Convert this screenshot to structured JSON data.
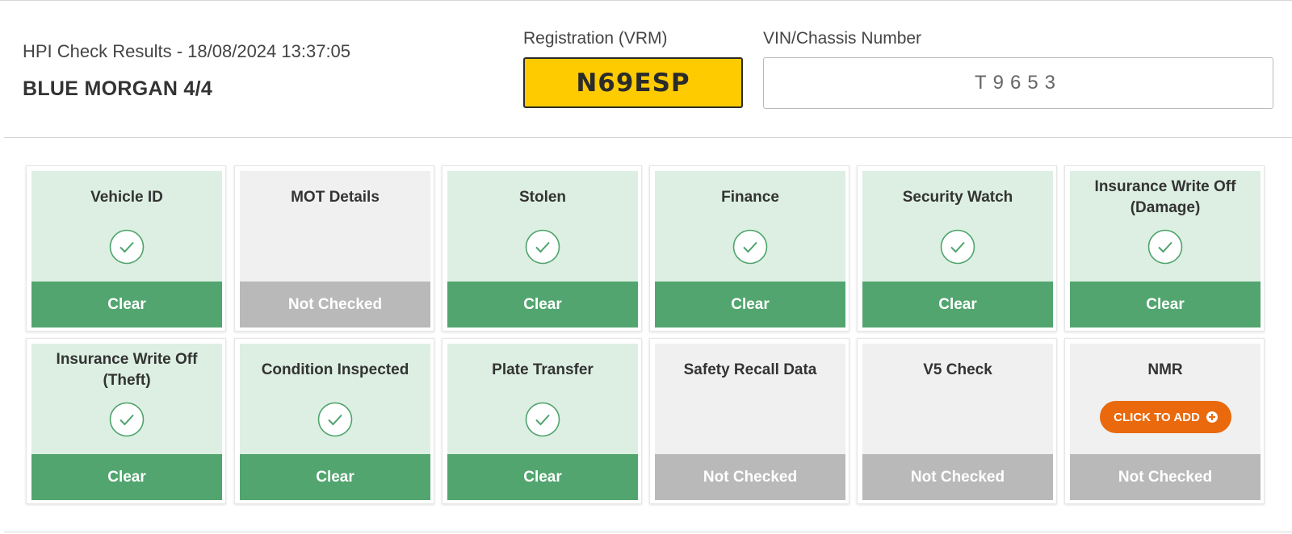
{
  "header": {
    "results_line": "HPI Check Results - 18/08/2024 13:37:05",
    "vehicle_name": "BLUE MORGAN 4/4",
    "registration_label": "Registration (VRM)",
    "registration_value": "N69ESP",
    "vin_label": "VIN/Chassis Number",
    "vin_value": "T9653"
  },
  "checks": [
    {
      "title": "Vehicle ID",
      "status": "Clear",
      "icon": "check-circle-icon"
    },
    {
      "title": "MOT Details",
      "status": "Not Checked"
    },
    {
      "title": "Stolen",
      "status": "Clear",
      "icon": "check-circle-icon"
    },
    {
      "title": "Finance",
      "status": "Clear",
      "icon": "check-circle-icon"
    },
    {
      "title": "Security Watch",
      "status": "Clear",
      "icon": "check-circle-icon"
    },
    {
      "title_line1": "Insurance Write Off",
      "title_line2": "(Damage)",
      "status": "Clear",
      "icon": "check-circle-icon"
    },
    {
      "title_line1": "Insurance Write Off",
      "title_line2": "(Theft)",
      "status": "Clear",
      "icon": "check-circle-icon"
    },
    {
      "title": "Condition Inspected",
      "status": "Clear",
      "icon": "check-circle-icon"
    },
    {
      "title": "Plate Transfer",
      "status": "Clear",
      "icon": "check-circle-icon"
    },
    {
      "title": "Safety Recall Data",
      "status": "Not Checked"
    },
    {
      "title": "V5 Check",
      "status": "Not Checked"
    },
    {
      "title": "NMR",
      "status": "Not Checked",
      "button_label": "CLICK TO ADD",
      "button_icon": "plus-circle-icon"
    }
  ],
  "colors": {
    "clear_bg": "#dcefe2",
    "clear_bar": "#52a56f",
    "not_checked_bg": "#f0f0f0",
    "not_checked_bar": "#b9b9b9",
    "plate_yellow": "#fecb00",
    "action_orange": "#e9690c"
  }
}
